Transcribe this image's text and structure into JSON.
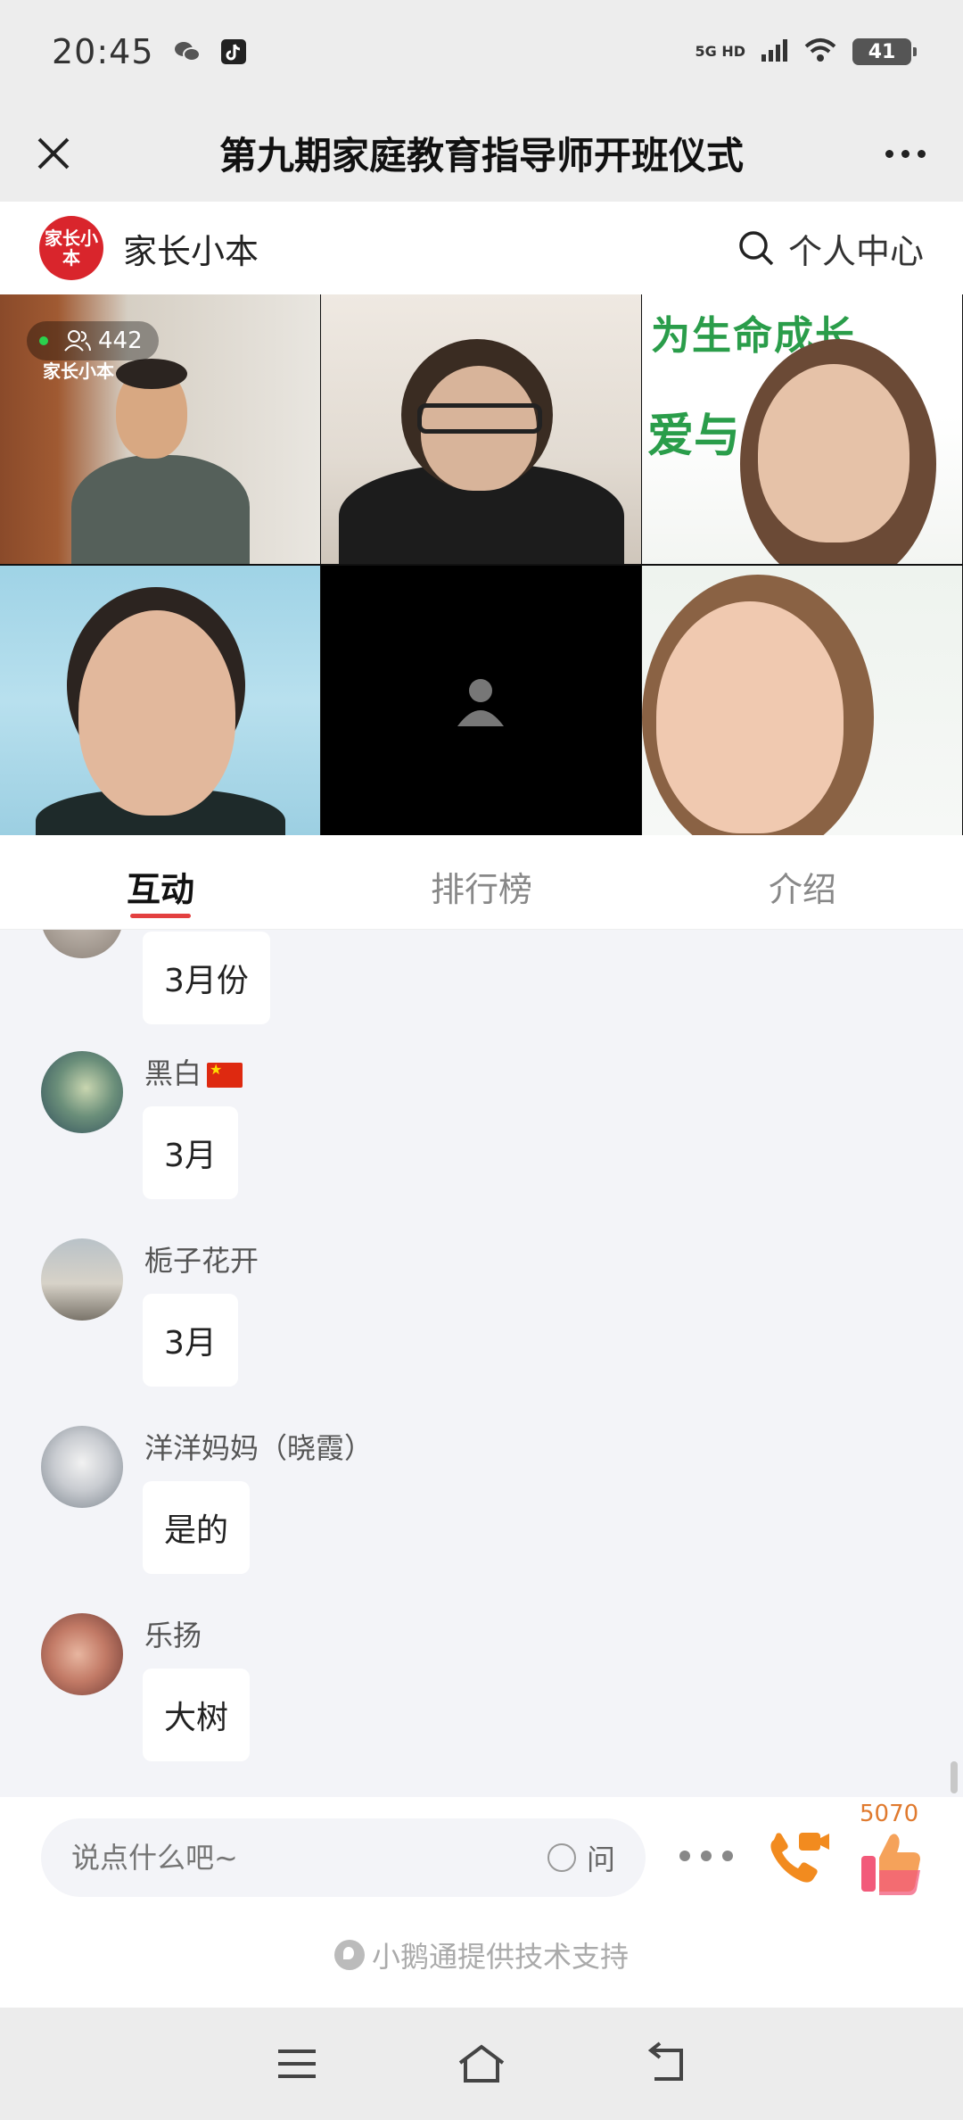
{
  "status": {
    "time": "20:45",
    "network": "5G HD",
    "battery": "41"
  },
  "titlebar": {
    "title": "第九期家庭教育指导师开班仪式"
  },
  "brand": {
    "logo_text": "家长小本",
    "name": "家长小本",
    "personal_center": "个人中心"
  },
  "video": {
    "viewer_count": "442",
    "host_tag": "家长小本",
    "banner_text_top": "为生命成长",
    "banner_text_bottom": "爱与"
  },
  "tabs": [
    {
      "label": "互动",
      "active": true
    },
    {
      "label": "排行榜",
      "active": false
    },
    {
      "label": "介绍",
      "active": false
    }
  ],
  "messages": [
    {
      "user": "",
      "text": "3月份",
      "avatar": "avatar-partial"
    },
    {
      "user": "黑白",
      "text": "3月",
      "avatar": "avatar-cat",
      "flag": "cn-flag-icon"
    },
    {
      "user": "栀子花开",
      "text": "3月",
      "avatar": "avatar-beach"
    },
    {
      "user": "洋洋妈妈（晓霞）",
      "text": "是的",
      "avatar": "avatar-rabbit"
    },
    {
      "user": "乐扬",
      "text": "大树",
      "avatar": "avatar-hands"
    }
  ],
  "input": {
    "placeholder": "说点什么吧~",
    "ask_label": "问"
  },
  "likes": {
    "count": "5070"
  },
  "support_text": "小鹅通提供技术支持",
  "colors": {
    "accent_red": "#e34040",
    "call_orange": "#f28b1f",
    "like_pink": "#f25a7a"
  }
}
